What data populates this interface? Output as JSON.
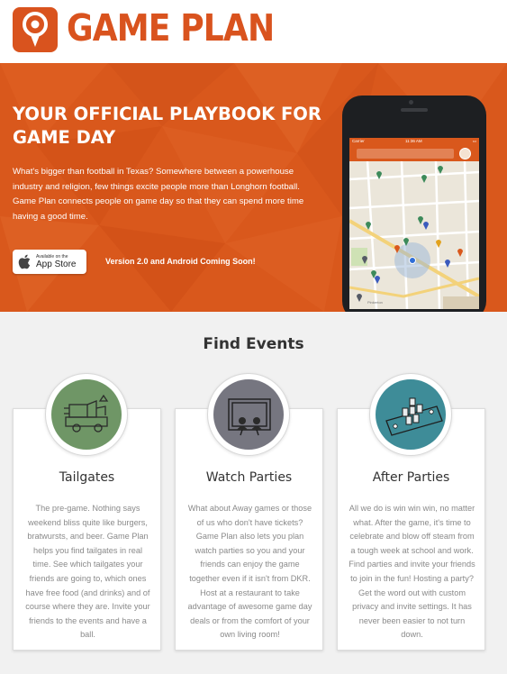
{
  "header": {
    "logo_text": "GAME PLAN",
    "brand_color": "#d9531e"
  },
  "hero": {
    "title": "YOUR OFFICIAL PLAYBOOK FOR GAME DAY",
    "description": "What's bigger than football in Texas? Somewhere between a powerhouse industry and religion, few things excite people more than Longhorn football. Game Plan connects people on game day so that they can spend more time having a good time.",
    "app_store": {
      "small_label": "Available on the",
      "big_label": "App Store"
    },
    "coming_soon": "Version 2.0 and Android Coming Soon!"
  },
  "phone": {
    "carrier": "Carrier",
    "time": "11:36 AM",
    "map_label": "Pinkerton"
  },
  "find_events": {
    "title": "Find Events",
    "cards": [
      {
        "title": "Tailgates",
        "icon": "tailgate-icon",
        "color": "#6f9666",
        "text": "The pre-game. Nothing says weekend bliss quite like burgers, bratwursts, and beer. Game Plan helps you find tailgates in real time. See which tailgates your friends are going to, which ones have free food (and drinks) and of course where they are. Invite your friends to the events and have a ball."
      },
      {
        "title": "Watch Parties",
        "icon": "tv-icon",
        "color": "#767680",
        "text": "What about Away games or those of us who don't have tickets? Game Plan also lets you plan watch parties so you and your friends can enjoy the game together even if it isn't from DKR. Host at a restaurant to take advantage of awesome game day deals or from the comfort of your own living room!"
      },
      {
        "title": "After Parties",
        "icon": "party-cups-icon",
        "color": "#3e8c98",
        "text": "All we do is win win win, no matter what. After the game, it's time to celebrate and blow off steam from a tough week at school and work. Find parties and invite your friends to join in the fun! Hosting a party? Get the word out with custom privacy and invite settings. It has never been easier to not turn down."
      }
    ]
  }
}
